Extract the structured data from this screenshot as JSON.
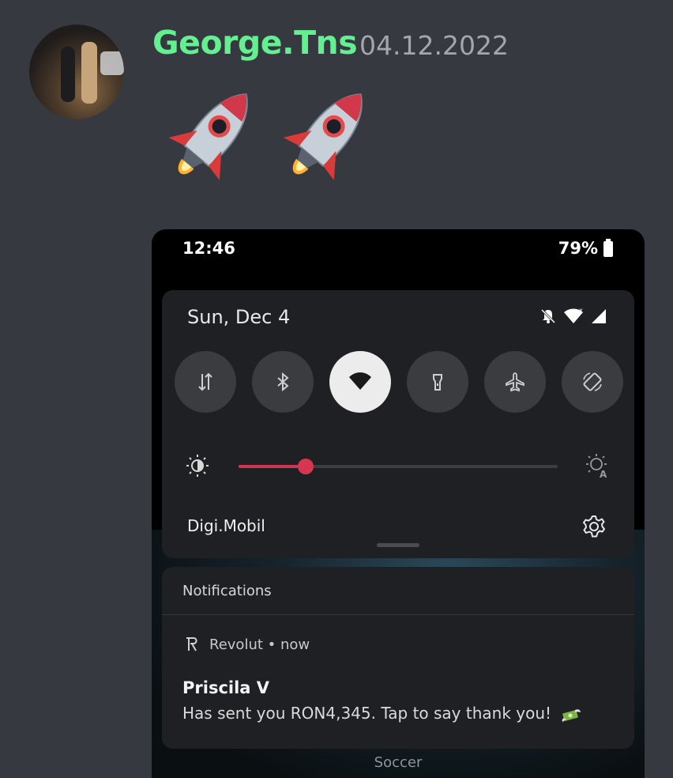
{
  "message": {
    "username": "George.Tns",
    "timestamp": "04.12.2022",
    "emojis": [
      "rocket-emoji",
      "rocket-emoji"
    ]
  },
  "phone": {
    "status_bar": {
      "time": "12:46",
      "battery": "79%"
    },
    "quick_settings": {
      "date": "Sun, Dec 4",
      "status_icons": [
        "bell-off-icon",
        "wifi-icon",
        "signal-icon"
      ],
      "tiles": [
        {
          "name": "mobile-data",
          "icon": "mobile-data-icon",
          "active": false
        },
        {
          "name": "bluetooth",
          "icon": "bluetooth-icon",
          "active": false
        },
        {
          "name": "wifi",
          "icon": "wifi-icon",
          "active": true
        },
        {
          "name": "flashlight",
          "icon": "flashlight-icon",
          "active": false
        },
        {
          "name": "airplane-mode",
          "icon": "airplane-icon",
          "active": false
        },
        {
          "name": "auto-rotate",
          "icon": "rotate-icon",
          "active": false
        }
      ],
      "brightness_level": 0.21,
      "carrier": "Digi.Mobil"
    },
    "notifications": {
      "header": "Notifications",
      "items": [
        {
          "app": "Revolut",
          "time": "now",
          "app_line": "Revolut • now",
          "title": "Priscila V",
          "body": "Has sent you RON4,345. Tap to say thank you!",
          "emoji": "money-with-wings-emoji"
        }
      ]
    },
    "footer_label": "Soccer"
  },
  "colors": {
    "background": "#36393f",
    "username": "#64f091",
    "timestamp": "#a3a6aa",
    "slider_accent": "#cf3553",
    "panel": "#1f2023"
  }
}
